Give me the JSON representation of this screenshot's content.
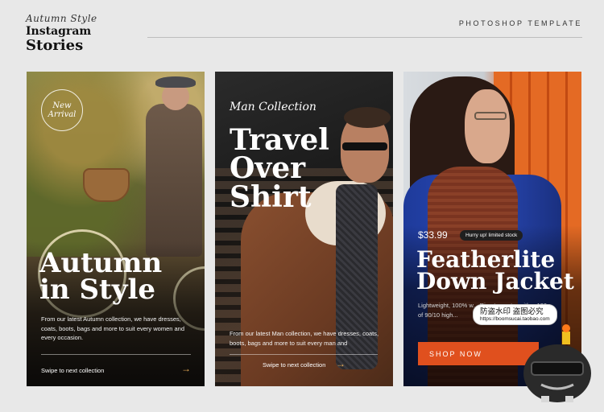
{
  "header": {
    "script_title": "Autumn Style",
    "title_line1": "Instagram",
    "title_line2": "Stories",
    "template_label": "PHOTOSHOP TEMPLATE"
  },
  "cards": [
    {
      "badge_line1": "New",
      "badge_line2": "Arrival",
      "title_line1": "Autumn",
      "title_line2": "in Style",
      "description": "From our latest Autumn collection, we have dresses, coats, boots, bags and more to suit every women and every occasion.",
      "swipe_label": "Swipe to next collection",
      "arrow": "→"
    },
    {
      "script_label": "Man Collection",
      "title_line1": "Travel",
      "title_line2": "Over",
      "title_line3": "Shirt",
      "description": "From our latest Man collection, we have dresses, coats, boots, bags and more to suit every man and",
      "swipe_label": "Swipe to next collection",
      "arrow": "→"
    },
    {
      "price": "$33.99",
      "stock_badge": "Hurry up! limited stock",
      "title_line1": "Featherlite",
      "title_line2": "Down Jacket",
      "description": "Lightweight, 100% w... Rip-stop outer with... 120g of 90/10 high...",
      "cta_label": "SHOP NOW"
    }
  ],
  "watermark": {
    "line1": "防盗水印 盗图必究",
    "line2": "https://boomsucai.taobao.com"
  },
  "colors": {
    "accent": "#e0501e",
    "arrow": "#f0b45a",
    "background": "#e8e8e8"
  }
}
